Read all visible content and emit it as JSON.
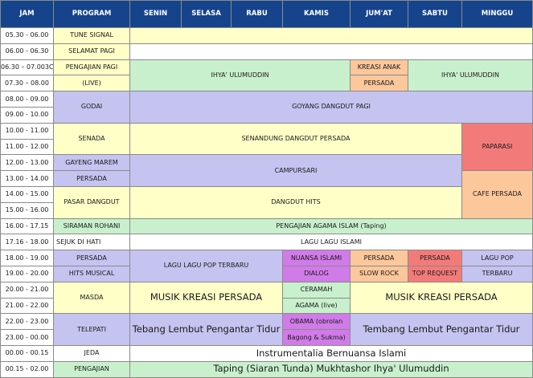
{
  "header": [
    "JAM",
    "PROGRAM",
    "SENIN",
    "SELASA",
    "RABU",
    "KAMIS",
    "JUM'AT",
    "SABTU",
    "MINGGU"
  ],
  "jam": [
    "05.30 - 06.00",
    "06.00 - 06.30",
    "06.30 – 07.003C",
    "07.30 – 08.00",
    "08.00 - 09.00",
    "09.00 - 10.00",
    "10.00 - 11.00",
    "11.00 - 12.00",
    "12.00 - 13.00",
    "13.00 - 14.00",
    "14.00 - 15.00",
    "15.00 - 16.00",
    "16.00 - 17.15",
    "17.16 - 18.00",
    "18.00 - 19.00",
    "19.00 - 20.00",
    "20.00 - 21.00",
    "21.00 - 22.00",
    "22.00 - 23.00",
    "23.00 - 00.00",
    "00.00 - 00.15",
    "00.15 - 02.00"
  ],
  "program": {
    "tune_signal": "TUNE SIGNAL",
    "selamat_pagi": "SELAMAT PAGI",
    "pengajian_pagi_1": "PENGAJIAN PAGI",
    "pengajian_pagi_2": "(LIVE)",
    "godai": "GODAI",
    "senada": "SENADA",
    "gayeng_1": "GAYENG MAREM",
    "gayeng_2": "PERSADA",
    "pasar_dangdut": "PASAR DANGDUT",
    "siraman_rohani": "SIRAMAN ROHANI",
    "sejuk_di_hati": "SEJUK DI HATI",
    "persada_1": "PERSADA",
    "persada_2": "HITS MUSICAL",
    "masda": "MASDA",
    "telepati": "TELEPATI",
    "jeda": "JEDA",
    "pengajian": "PENGAJIAN"
  },
  "cells": {
    "ihya_weekday": "IHYA' ULUMUDDIN",
    "kreasi_anak_1": "KREASI ANAK",
    "kreasi_anak_2": "PERSADA",
    "ihya_weekend": "IHYA' ULUMUDDIN",
    "goyang_dangdut": "GOYANG DANGDUT PAGI",
    "senandung": "SENANDUNG DANGDUT PERSADA",
    "paparasi": "PAPARASI",
    "campursari": "CAMPURSARI",
    "cafe_persada": "CAFE PERSADA",
    "dangdut_hits": "DANGDUT HITS",
    "pengajian_agama": "PENGAJIAN AGAMA ISLAM (Taping)",
    "lagu_islami": "LAGU LAGU ISLAMI",
    "lagu_pop": "LAGU LAGU POP TERBARU",
    "nuansa_islami": "NUANSA ISLAMI",
    "dialog": "DIALOG",
    "slow_rock_1": "PERSADA",
    "slow_rock_2": "SLOW ROCK",
    "top_request_1": "PERSADA",
    "top_request_2": "TOP REQUEST",
    "lagu_pop_minggu_1": "LAGU POP",
    "lagu_pop_minggu_2": "TERBARU",
    "musik_kreasi_left": "MUSIK KREASI PERSADA",
    "ceramah_1": "CERAMAH",
    "ceramah_2": "AGAMA (live)",
    "musik_kreasi_right": "MUSIK KREASI PERSADA",
    "tebang_lembut": "Tebang Lembut Pengantar Tidur",
    "obama_1": "OBAMA (obrolan",
    "obama_2": "Bagong & Sukma)",
    "tembang_lembut": "Tembang Lembut Pengantar Tidur",
    "instrumentalia": "Instrumentalia Bernuansa Islami",
    "taping": "Taping (Siaran Tunda) Mukhtashor Ihya' Ulumuddin"
  },
  "colors": {
    "header_bg": "#16448c",
    "yellow": "#ffffc8",
    "green": "#c9f0cc",
    "orange": "#fbc79b",
    "purple": "#c5c3f0",
    "red": "#f27b7a",
    "magenta": "#d07be8"
  }
}
